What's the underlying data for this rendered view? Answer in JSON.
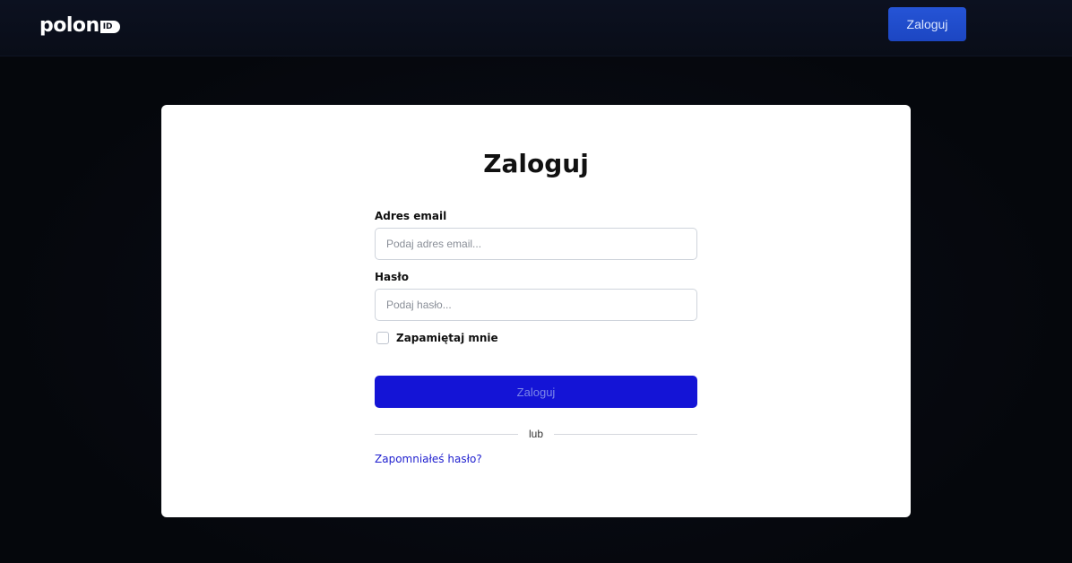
{
  "header": {
    "logo_text": "polon",
    "logo_badge": "ID",
    "login_button": "Zaloguj",
    "login_button_color": "#1d4ed8"
  },
  "login_form": {
    "title": "Zaloguj",
    "email": {
      "label": "Adres email",
      "placeholder": "Podaj adres email...",
      "value": ""
    },
    "password": {
      "label": "Hasło",
      "placeholder": "Podaj hasło...",
      "value": ""
    },
    "remember_me": {
      "label": "Zapamiętaj mnie",
      "checked": false
    },
    "submit_label": "Zaloguj",
    "submit_color": "#1414d6",
    "divider_text": "lub",
    "forgot_password_link": "Zapomniałeś hasło?"
  },
  "icons": {
    "logo": "polon-id-logo"
  }
}
